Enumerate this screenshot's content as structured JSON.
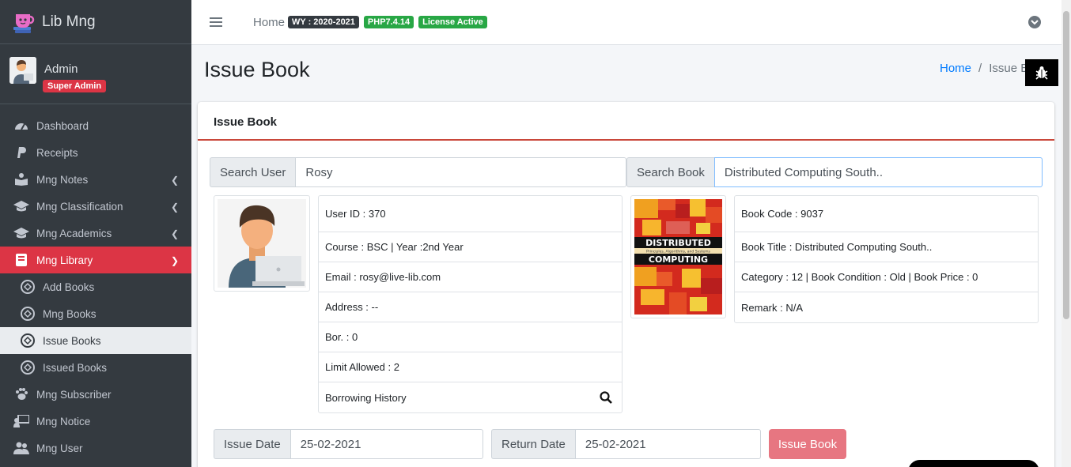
{
  "brand": {
    "title": "Lib Mng"
  },
  "user": {
    "name": "Admin",
    "role": "Super Admin"
  },
  "sidebar": {
    "items": [
      {
        "label": "Dashboard",
        "icon": "gauge-icon"
      },
      {
        "label": "Receipts",
        "icon": "paypal-icon"
      },
      {
        "label": "Mng Notes",
        "icon": "book-reader-icon"
      },
      {
        "label": "Mng Classification",
        "icon": "graduation-cap-icon"
      },
      {
        "label": "Mng Academics",
        "icon": "graduation-cap-icon"
      },
      {
        "label": "Mng Library",
        "icon": "book-icon"
      },
      {
        "label": "Add Books",
        "icon": "circle-link-icon"
      },
      {
        "label": "Mng Books",
        "icon": "circle-link-icon"
      },
      {
        "label": "Issue Books",
        "icon": "circle-link-icon"
      },
      {
        "label": "Issued Books",
        "icon": "circle-link-icon"
      },
      {
        "label": "Mng Subscriber",
        "icon": "paw-icon"
      },
      {
        "label": "Mng Notice",
        "icon": "chalkboard-teacher-icon"
      },
      {
        "label": "Mng User",
        "icon": "users-icon"
      }
    ]
  },
  "topbar": {
    "home": "Home",
    "badges": [
      "WY : 2020-2021",
      "PHP7.4.14",
      "License Active"
    ]
  },
  "page": {
    "title": "Issue Book"
  },
  "breadcrumb": {
    "home": "Home",
    "current": "Issue B"
  },
  "card": {
    "title": "Issue Book"
  },
  "search_user": {
    "label": "Search User",
    "value": "Rosy"
  },
  "search_book": {
    "label": "Search Book",
    "value": "Distributed Computing South.."
  },
  "user_details": {
    "user_id": "User ID : 370",
    "course": "Course : BSC | Year :2nd Year",
    "email": "Email : rosy@live-lib.com",
    "address": "Address : --",
    "borrowed": "Bor. : 0",
    "limit": "Limit Allowed : 2",
    "history": "Borrowing History"
  },
  "book_details": {
    "code": "Book Code : 9037",
    "title": "Book Title : Distributed Computing South..",
    "category": "Category : 12 | Book Condition : Old | Book Price : 0",
    "remark": "Remark : N/A"
  },
  "book_cover": {
    "line1": "DISTRIBUTED",
    "subtitle": "Principles, Algorithms, and Systems",
    "line2": "COMPUTING"
  },
  "issue_date": {
    "label": "Issue Date",
    "value": "25-02-2021"
  },
  "return_date": {
    "label": "Return Date",
    "value": "25-02-2021"
  },
  "issue_button": {
    "label": "Issue Book"
  },
  "colors": {
    "sidebar": "#343a40",
    "active": "#dc3545",
    "success": "#28a745",
    "link": "#007bff",
    "issue_button": "#e77681"
  }
}
